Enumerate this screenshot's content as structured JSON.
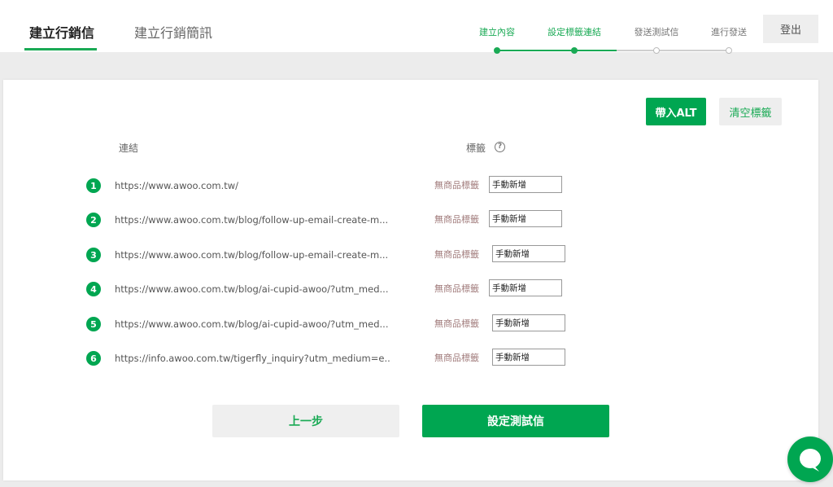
{
  "header": {
    "tabs": [
      {
        "label": "建立行銷信"
      },
      {
        "label": "建立行銷簡訊"
      }
    ],
    "steps": [
      {
        "label": "建立內容"
      },
      {
        "label": "設定標籤連結"
      },
      {
        "label": "發送測試信"
      },
      {
        "label": "進行發送"
      }
    ],
    "logout_label": "登出"
  },
  "toolbar": {
    "alt_label": "帶入ALT",
    "clear_label": "清空標籤"
  },
  "table": {
    "col_link": "連結",
    "col_tag": "標籤",
    "help_glyph": "?",
    "rows": [
      {
        "num": "1",
        "url": "https://www.awoo.com.tw/",
        "no_tag": "無商品標籤",
        "tag_value": "手動新增"
      },
      {
        "num": "2",
        "url": "https://www.awoo.com.tw/blog/follow-up-email-create-m...",
        "no_tag": "無商品標籤",
        "tag_value": "手動新增"
      },
      {
        "num": "3",
        "url": "https://www.awoo.com.tw/blog/follow-up-email-create-m...",
        "no_tag": "無商品標籤",
        "tag_value": "手動新增"
      },
      {
        "num": "4",
        "url": "https://www.awoo.com.tw/blog/ai-cupid-awoo/?utm_med...",
        "no_tag": "無商品標籤",
        "tag_value": "手動新增"
      },
      {
        "num": "5",
        "url": "https://www.awoo.com.tw/blog/ai-cupid-awoo/?utm_med...",
        "no_tag": "無商品標籤",
        "tag_value": "手動新增"
      },
      {
        "num": "6",
        "url": "https://info.awoo.com.tw/tigerfly_inquiry?utm_medium=e...",
        "no_tag": "無商品標籤",
        "tag_value": "手動新增"
      }
    ]
  },
  "footer": {
    "prev_label": "上一步",
    "next_label": "設定測試信"
  },
  "colors": {
    "accent": "#00a651",
    "accent_text": "#1aaa55",
    "no_tag_text": "#a07a7a"
  },
  "icons": {
    "help": "question-circle-icon",
    "chat": "chat-bubble-icon"
  }
}
